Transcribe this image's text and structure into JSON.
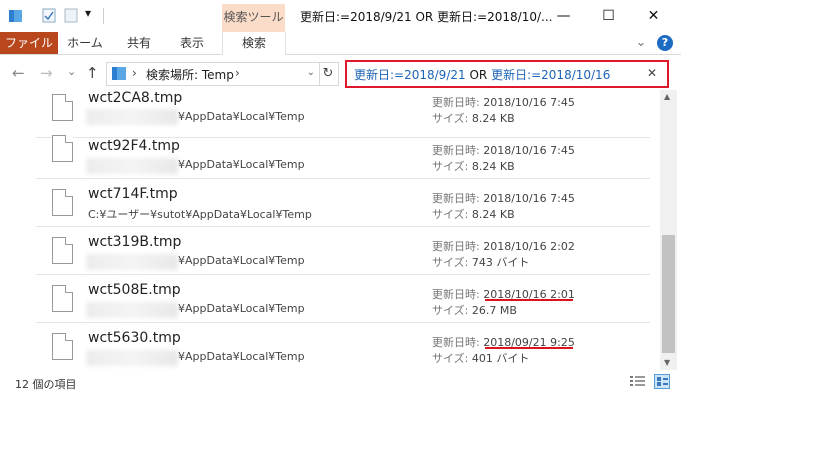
{
  "window": {
    "contextual_tab": "検索ツール",
    "title": "更新日:=2018/9/21 OR 更新日:=2018/10/...",
    "minimize_glyph": "—",
    "maximize_glyph": "☐",
    "close_glyph": "✕",
    "qa_dropdown_glyph": "▾"
  },
  "ribbon": {
    "tabs": [
      "ファイル",
      "ホーム",
      "共有",
      "表示",
      "検索"
    ],
    "collapse_glyph": "⌄",
    "help_glyph": "?"
  },
  "nav": {
    "back_glyph": "←",
    "forward_glyph": "→",
    "recent_glyph": "⌄",
    "up_glyph": "↑",
    "breadcrumb_sep": "›",
    "breadcrumb": "検索場所: Temp",
    "breadcrumb_end": "›",
    "refresh_glyph": "↻"
  },
  "search": {
    "part1": "更新日:=2018/9/21",
    "op": " OR ",
    "part2": "更新日:=2018/10/16",
    "clear_glyph": "✕"
  },
  "labels": {
    "modified": "更新日時:",
    "size": "サイズ:"
  },
  "files": [
    {
      "name": "wct2CA8.tmp",
      "path": "¥AppData¥Local¥Temp",
      "date": "2018/10/16 7:45",
      "size": "8.24 KB"
    },
    {
      "name": "wct92F4.tmp",
      "path": "¥AppData¥Local¥Temp",
      "date": "2018/10/16 7:45",
      "size": "8.24 KB"
    },
    {
      "name": "wct714F.tmp",
      "path": "C:¥ユーザー¥sutot¥AppData¥Local¥Temp",
      "date": "2018/10/16 7:45",
      "size": "8.24 KB"
    },
    {
      "name": "wct319B.tmp",
      "path": "¥AppData¥Local¥Temp",
      "date": "2018/10/16 2:02",
      "size": "743 バイト"
    },
    {
      "name": "wct508E.tmp",
      "path": "¥AppData¥Local¥Temp",
      "date": "2018/10/16 2:01",
      "size": "26.7 MB"
    },
    {
      "name": "wct5630.tmp",
      "path": "¥AppData¥Local¥Temp",
      "date": "2018/09/21 9:25",
      "size": "401 バイト"
    }
  ],
  "status": {
    "count": "12 個の項目"
  },
  "colors": {
    "accent_red": "#e0182e",
    "file_tab": "#b9471e",
    "search_blue": "#1c63b7",
    "context_tab": "#fbdcc8"
  },
  "icons": [
    "folder-icon",
    "properties-icon",
    "new-folder-icon",
    "chevron-down-icon",
    "minimize-icon",
    "maximize-icon",
    "close-icon",
    "help-icon",
    "back-icon",
    "forward-icon",
    "up-icon",
    "refresh-icon",
    "clear-icon",
    "file-icon",
    "details-view-icon",
    "tiles-view-icon"
  ]
}
